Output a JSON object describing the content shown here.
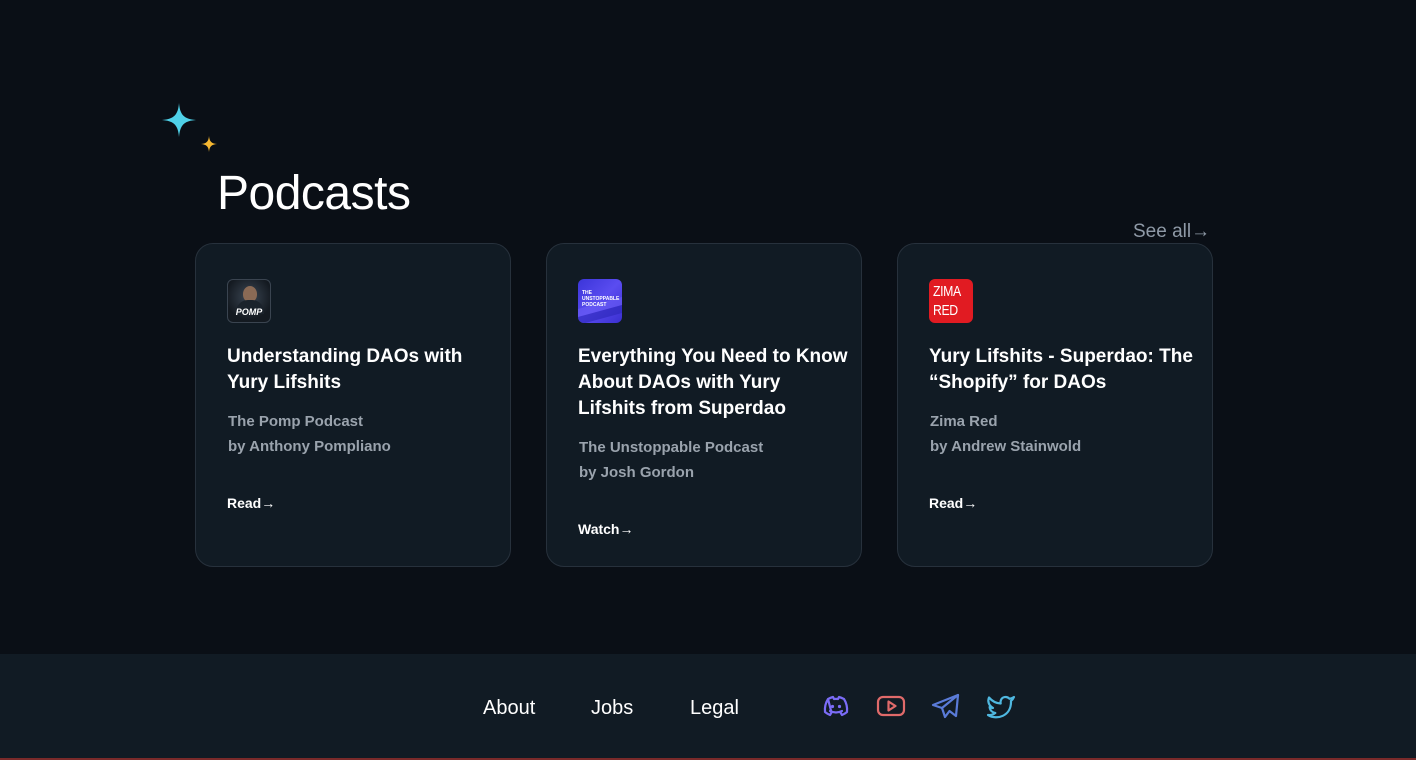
{
  "section": {
    "title": "Podcasts",
    "see_all": "See all→"
  },
  "cards": [
    {
      "thumb_label": "POMP",
      "title": "Understanding DAOs with Yury Lifshits",
      "show": "The Pomp Podcast",
      "author": "by Anthony Pompliano",
      "cta": "Read→"
    },
    {
      "thumb_label": "THE UNSTOPPABLE PODCAST",
      "title": "Everything You Need to Know About DAOs with Yury Lifshits from Superdao",
      "show": "The Unstoppable Podcast",
      "author": "by Josh Gordon",
      "cta": "Watch→"
    },
    {
      "thumb_label": "ZIMA RED",
      "title": "Yury Lifshits - Superdao: The “Shopify” for DAOs",
      "show": "Zima Red",
      "author": "by Andrew Stainwold",
      "cta": "Read→"
    }
  ],
  "footer": {
    "links": [
      "About",
      "Jobs",
      "Legal"
    ],
    "social": [
      "discord-icon",
      "youtube-icon",
      "telegram-icon",
      "twitter-icon"
    ]
  },
  "colors": {
    "background": "#0a0f16",
    "card": "#111b24",
    "sparkle_big": "#4fd1e8",
    "sparkle_small": "#f5b731",
    "discord": "#7b6cf6",
    "youtube": "#e06a6a",
    "telegram": "#5a7bd8",
    "twitter": "#4fb8e0"
  }
}
